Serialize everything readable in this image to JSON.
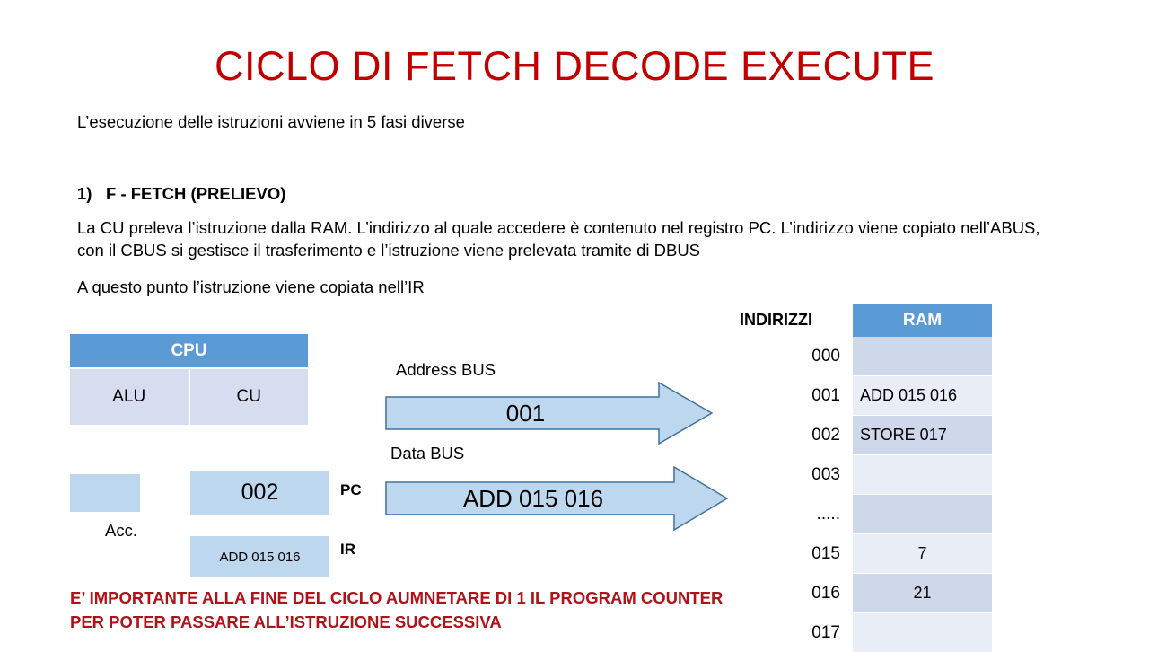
{
  "slide": {
    "title": "CICLO DI FETCH DECODE EXECUTE",
    "intro": "L’esecuzione delle istruzioni avviene in 5 fasi diverse",
    "phase_number": "1)",
    "phase_heading": "F - FETCH (PRELIEVO)",
    "fetch_paragraph": "La CU preleva l’istruzione dalla RAM. L’indirizzo al quale accedere è contenuto nel registro PC. L’indirizzo viene copiato nell’ABUS, con il CBUS si gestisce il trasferimento e l’istruzione viene prelevata tramite di DBUS",
    "ir_note": "A questo punto l’istruzione viene copiata nell’IR",
    "bottom_note_line1": "E’ IMPORTANTE ALLA FINE DEL CICLO AUMNETARE DI 1 IL PROGRAM COUNTER",
    "bottom_note_line2": "PER POTER PASSARE ALL’ISTRUZIONE SUCCESSIVA"
  },
  "colors": {
    "title_red": "#C00000",
    "note_red": "#B01218",
    "header_blue": "#5B9BD5",
    "cell_light_blue": "#D5DDEF",
    "register_blue": "#BDD7EE",
    "arrow_fill": "#BDD7EE",
    "arrow_stroke": "#41719C",
    "ram_row_odd": "#CFD8EA",
    "ram_row_even": "#E9EDF6"
  },
  "cpu": {
    "header": "CPU",
    "units": [
      {
        "label": "ALU"
      },
      {
        "label": "CU"
      }
    ]
  },
  "registers": {
    "acc": {
      "label": "Acc.",
      "value": ""
    },
    "pc": {
      "label": "PC",
      "value": "002"
    },
    "ir": {
      "label": "IR",
      "value": "ADD 015 016"
    }
  },
  "buses": [
    {
      "caption": "Address BUS",
      "value": "001",
      "direction": "right"
    },
    {
      "caption": "Data BUS",
      "value": "ADD 015 016",
      "direction": "right"
    }
  ],
  "memory": {
    "addresses_header": "INDIRIZZI",
    "ram_header": "RAM",
    "rows": [
      {
        "address": "000",
        "value": "",
        "kind": "blank"
      },
      {
        "address": "001",
        "value": "ADD 015 016",
        "kind": "instr"
      },
      {
        "address": "002",
        "value": "STORE 017",
        "kind": "instr"
      },
      {
        "address": "003",
        "value": "",
        "kind": "blank"
      },
      {
        "address": ".....",
        "value": "",
        "kind": "blank"
      },
      {
        "address": "015",
        "value": "7",
        "kind": "value"
      },
      {
        "address": "016",
        "value": "21",
        "kind": "value"
      },
      {
        "address": "017",
        "value": "",
        "kind": "blank"
      }
    ]
  }
}
